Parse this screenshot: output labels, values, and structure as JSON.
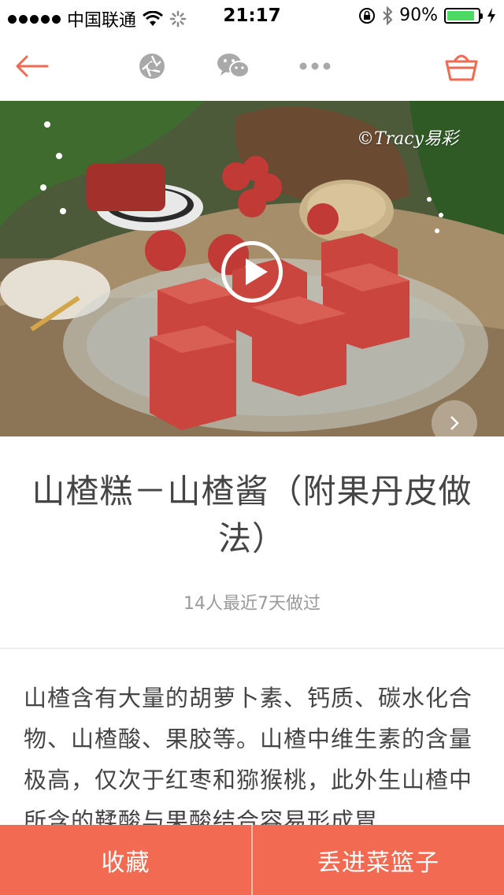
{
  "status_bar": {
    "carrier": "中国联通",
    "time": "21:17",
    "battery_percent": "90%",
    "battery_level": 0.9,
    "icons": [
      "signal-dots-icon",
      "wifi-icon",
      "loading-spinner-icon",
      "orientation-lock-icon",
      "bluetooth-icon",
      "battery-icon",
      "charging-bolt-icon"
    ]
  },
  "nav_bar": {
    "icons": [
      "back-arrow-icon",
      "moments-icon",
      "wechat-icon",
      "more-dots-icon",
      "basket-icon"
    ]
  },
  "hero": {
    "credit": "©Tracy易彩",
    "icons": [
      "play-icon",
      "next-arrow-icon"
    ]
  },
  "recipe": {
    "title": "山楂糕－山楂酱（附果丹皮做法）",
    "made_count": "14人最近7天做过",
    "description": "山楂含有大量的胡萝卜素、钙质、碳水化合物、山楂酸、果胶等。山楂中维生素的含量极高，仅次于红枣和猕猴桃，此外生山楂中所含的鞣酸与果酸结合容易形成胃"
  },
  "bottom_bar": {
    "favorite_label": "收藏",
    "basket_label": "丢进菜篮子"
  },
  "colors": {
    "accent": "#f26a52",
    "icon_gray": "#a9a9a9",
    "title_text": "#454545",
    "muted_text": "#9a9a9a"
  }
}
